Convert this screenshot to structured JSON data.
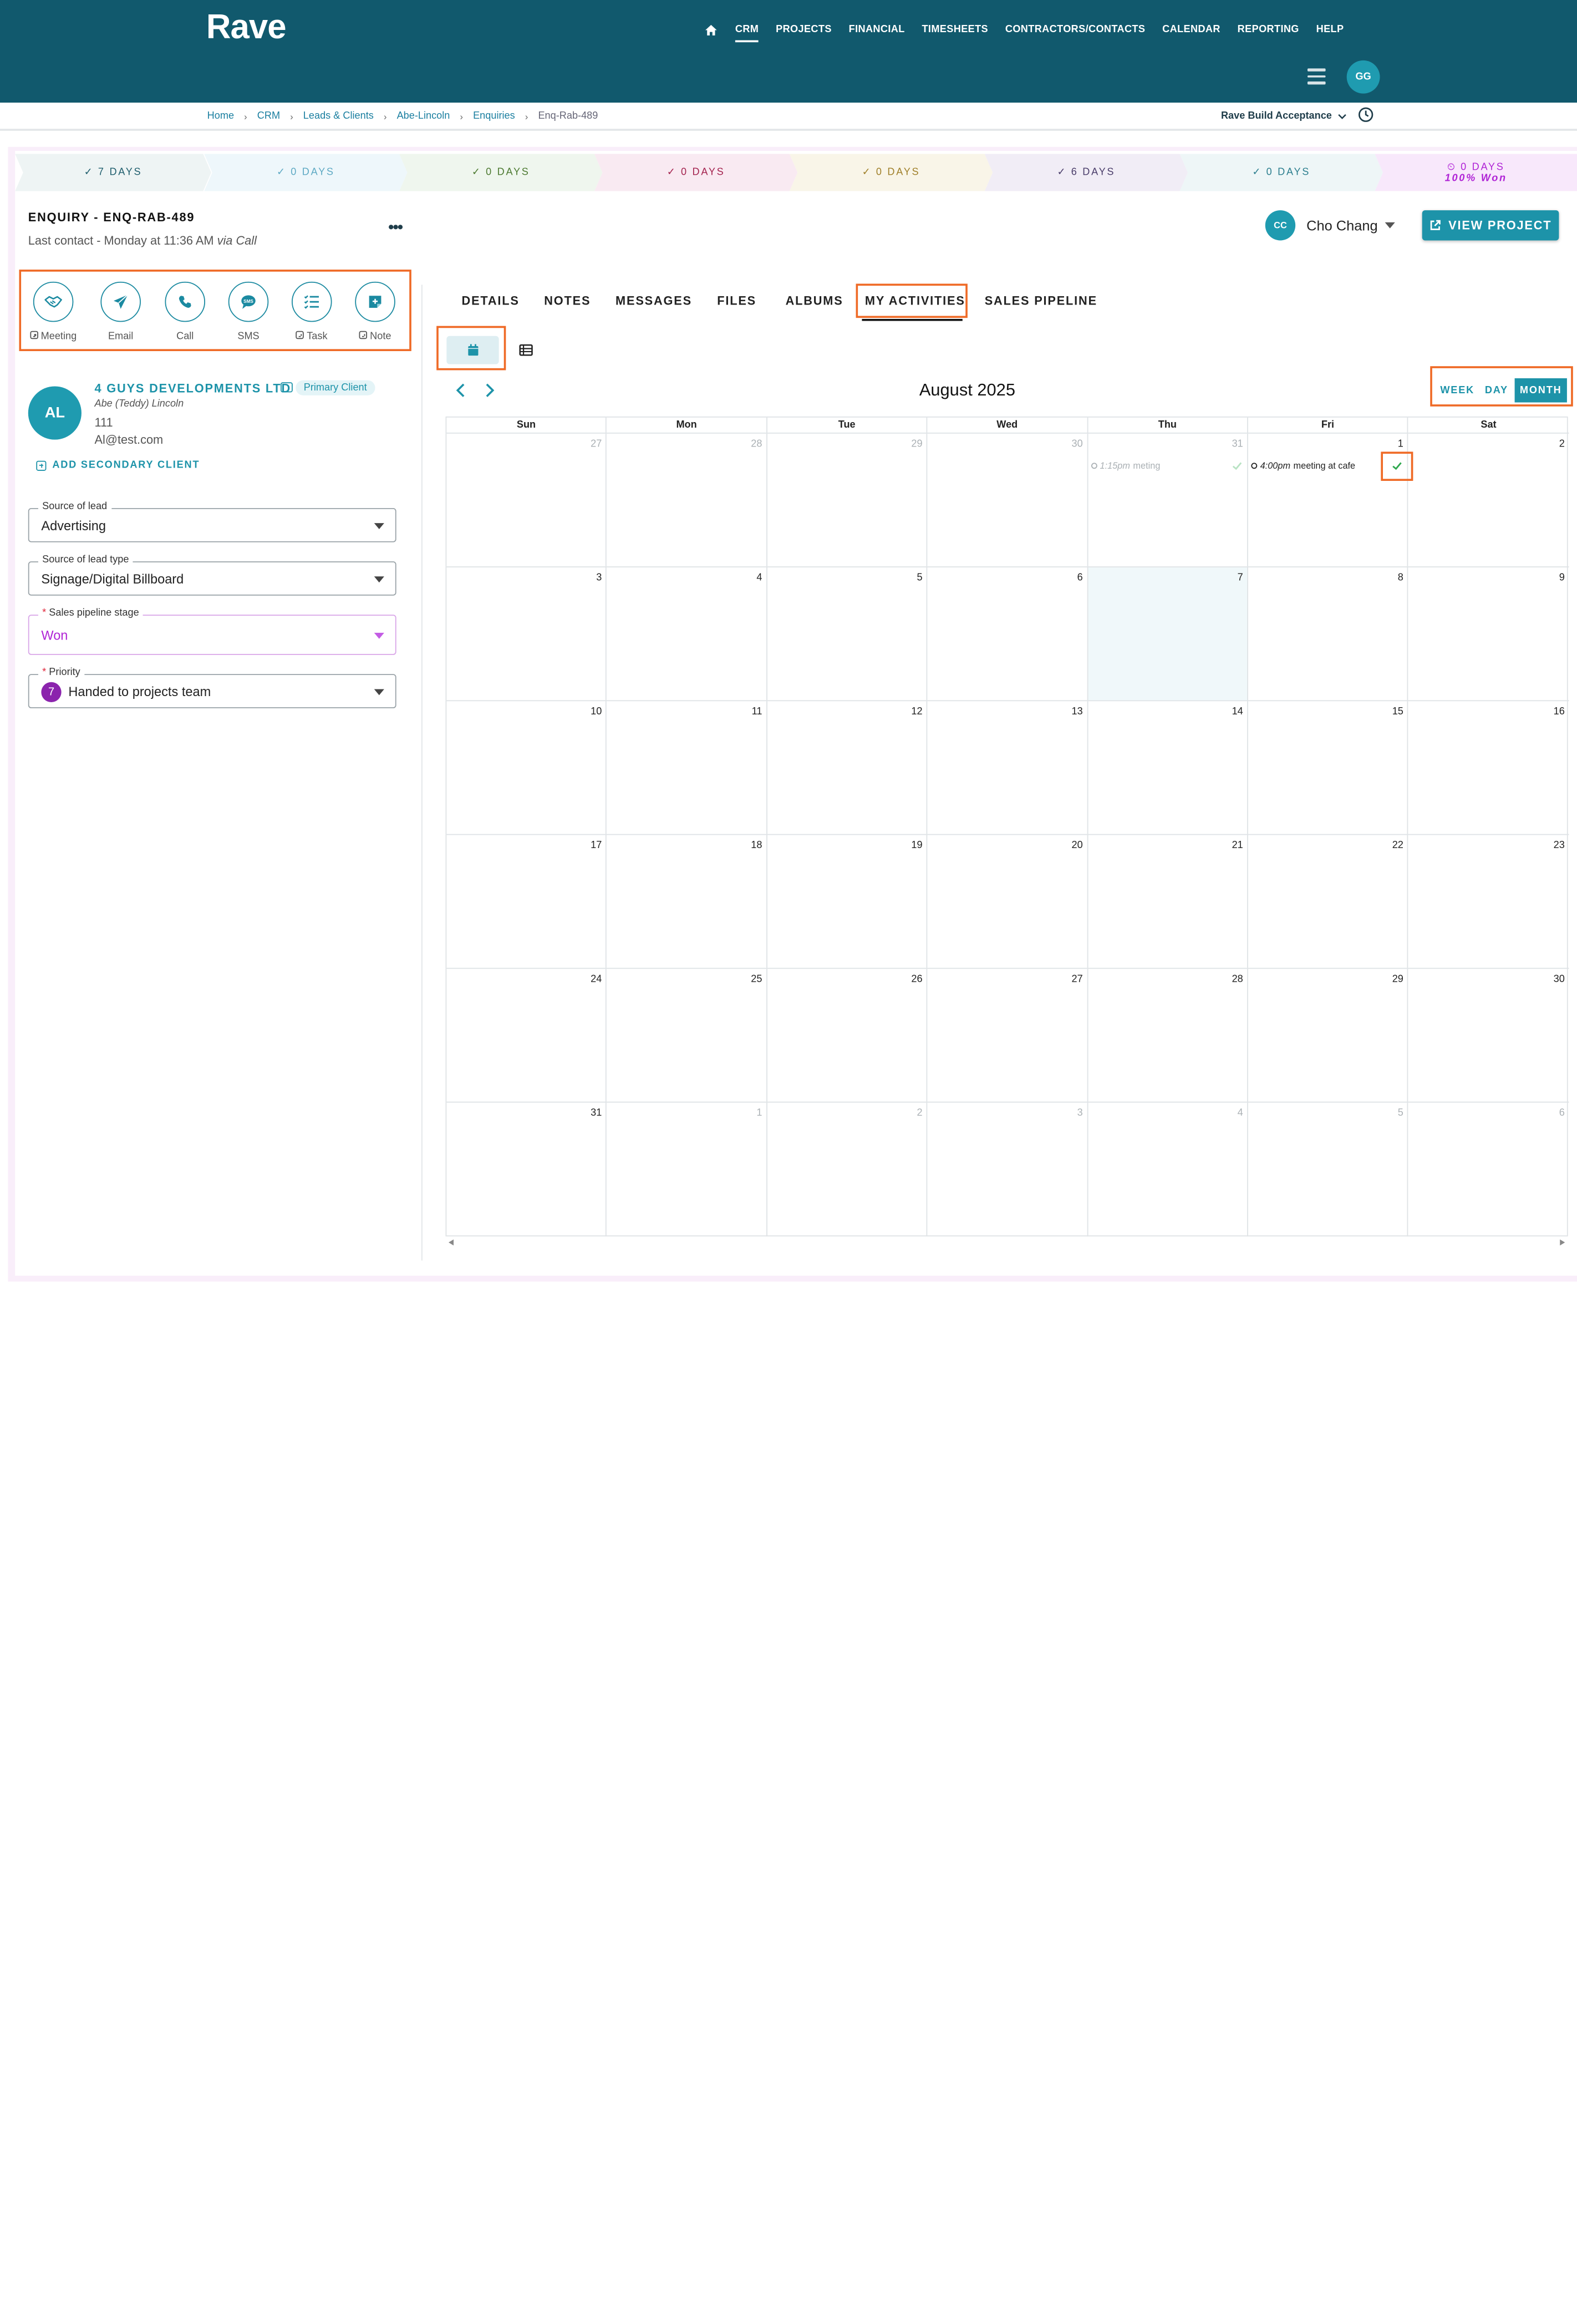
{
  "brand": {
    "logo": "Rave"
  },
  "nav": {
    "items": [
      "CRM",
      "PROJECTS",
      "FINANCIAL",
      "TIMESHEETS",
      "CONTRACTORS/CONTACTS",
      "CALENDAR",
      "REPORTING",
      "HELP"
    ],
    "active": "CRM",
    "user_initials": "GG"
  },
  "breadcrumb": {
    "items": [
      "Home",
      "CRM",
      "Leads & Clients",
      "Abe-Lincoln",
      "Enquiries"
    ],
    "current": "Enq-Rab-489",
    "org": "Rave Build Acceptance"
  },
  "stages": [
    {
      "label": "7 DAYS",
      "icon": "check-icon"
    },
    {
      "label": "0 DAYS",
      "icon": "check-icon"
    },
    {
      "label": "0 DAYS",
      "icon": "check-icon"
    },
    {
      "label": "0 DAYS",
      "icon": "check-icon"
    },
    {
      "label": "0 DAYS",
      "icon": "check-icon"
    },
    {
      "label": "6 DAYS",
      "icon": "check-icon"
    },
    {
      "label": "0 DAYS",
      "icon": "check-icon"
    },
    {
      "label": "0 DAYS",
      "icon": "timer-icon",
      "sub": "100% Won"
    }
  ],
  "enquiry": {
    "title": "ENQUIRY - ENQ-RAB-489",
    "last_contact": "Last contact - Monday at 11:36 AM",
    "via": "via Call",
    "more": "•••"
  },
  "assignee": {
    "initials": "CC",
    "name": "Cho Chang"
  },
  "view_project_label": "VIEW PROJECT",
  "actions": [
    {
      "label": "Meeting",
      "icon": "handshake-icon",
      "plus": true
    },
    {
      "label": "Email",
      "icon": "paper-plane-icon",
      "plus": false
    },
    {
      "label": "Call",
      "icon": "phone-icon",
      "plus": false
    },
    {
      "label": "SMS",
      "icon": "sms-icon",
      "plus": false
    },
    {
      "label": "Task",
      "icon": "task-list-icon",
      "plus": true
    },
    {
      "label": "Note",
      "icon": "note-icon",
      "plus": true
    }
  ],
  "client": {
    "initials": "AL",
    "company": "4 GUYS DEVELOPMENTS LTD",
    "badge": "Primary Client",
    "contact": "Abe (Teddy) Lincoln",
    "phone": "111",
    "email": "Al@test.com",
    "add_secondary": "ADD SECONDARY CLIENT"
  },
  "fields": {
    "source": {
      "label": "Source of lead",
      "value": "Advertising"
    },
    "source_type": {
      "label": "Source of lead type",
      "value": "Signage/Digital Billboard"
    },
    "stage": {
      "label": "Sales pipeline stage",
      "value": "Won",
      "required": "*"
    },
    "priority": {
      "label": "Priority",
      "value": "Handed to projects team",
      "badge": "7",
      "required": "*"
    }
  },
  "tabs": [
    "DETAILS",
    "NOTES",
    "MESSAGES",
    "FILES",
    "ALBUMS",
    "MY ACTIVITIES",
    "SALES PIPELINE"
  ],
  "active_tab": "MY ACTIVITIES",
  "calendar": {
    "title": "August 2025",
    "ranges": [
      "WEEK",
      "DAY",
      "MONTH"
    ],
    "active_range": "MONTH",
    "weekdays": [
      "Sun",
      "Mon",
      "Tue",
      "Wed",
      "Thu",
      "Fri",
      "Sat"
    ],
    "weeks": [
      [
        {
          "n": "27",
          "muted": true
        },
        {
          "n": "28",
          "muted": true
        },
        {
          "n": "29",
          "muted": true
        },
        {
          "n": "30",
          "muted": true
        },
        {
          "n": "31",
          "muted": true,
          "event": {
            "time": "1:15pm",
            "title": "meting",
            "muted": true
          }
        },
        {
          "n": "1",
          "event": {
            "time": "4:00pm",
            "title": "meeting at cafe"
          }
        },
        {
          "n": "2"
        }
      ],
      [
        {
          "n": "3"
        },
        {
          "n": "4"
        },
        {
          "n": "5"
        },
        {
          "n": "6"
        },
        {
          "n": "7",
          "today": true
        },
        {
          "n": "8"
        },
        {
          "n": "9"
        }
      ],
      [
        {
          "n": "10"
        },
        {
          "n": "11"
        },
        {
          "n": "12"
        },
        {
          "n": "13"
        },
        {
          "n": "14"
        },
        {
          "n": "15"
        },
        {
          "n": "16"
        }
      ],
      [
        {
          "n": "17"
        },
        {
          "n": "18"
        },
        {
          "n": "19"
        },
        {
          "n": "20"
        },
        {
          "n": "21"
        },
        {
          "n": "22"
        },
        {
          "n": "23"
        }
      ],
      [
        {
          "n": "24"
        },
        {
          "n": "25"
        },
        {
          "n": "26"
        },
        {
          "n": "27"
        },
        {
          "n": "28"
        },
        {
          "n": "29"
        },
        {
          "n": "30"
        }
      ],
      [
        {
          "n": "31"
        },
        {
          "n": "1",
          "muted": true
        },
        {
          "n": "2",
          "muted": true
        },
        {
          "n": "3",
          "muted": true
        },
        {
          "n": "4",
          "muted": true
        },
        {
          "n": "5",
          "muted": true
        },
        {
          "n": "6",
          "muted": true
        }
      ]
    ]
  },
  "colors": {
    "header": "#11596d",
    "accent": "#1d93a9",
    "highlight": "#ef6a26",
    "won": "#b024d6"
  }
}
